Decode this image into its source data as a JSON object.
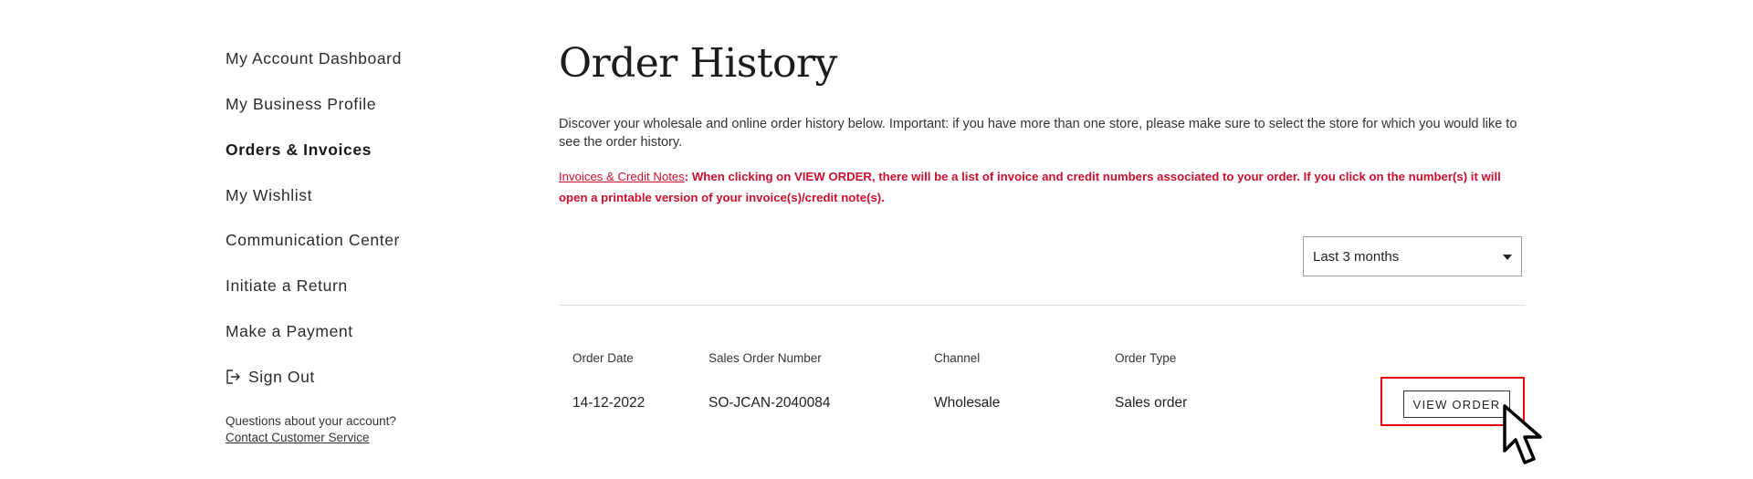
{
  "sidebar": {
    "items": [
      {
        "label": "My Account Dashboard"
      },
      {
        "label": "My Business Profile"
      },
      {
        "label": "Orders & Invoices"
      },
      {
        "label": "My Wishlist"
      },
      {
        "label": "Communication Center"
      },
      {
        "label": "Initiate a Return"
      },
      {
        "label": "Make a Payment"
      },
      {
        "label": "Sign Out"
      }
    ],
    "help_text": "Questions about your account?",
    "help_link": "Contact Customer Service"
  },
  "main": {
    "title": "Order History",
    "intro": "Discover your wholesale and online order history below. Important: if you have more than one store, please make sure to select the store for which you would like to see the order history.",
    "notice_link": "Invoices & Credit Notes",
    "notice_text": ": When clicking on VIEW ORDER, there will be a list of invoice and credit numbers associated to your order. If you click on the number(s) it will open a printable version of your invoice(s)/credit note(s).",
    "period_select": {
      "value": "Last 3 months"
    },
    "table": {
      "headers": [
        "Order Date",
        "Sales Order Number",
        "Channel",
        "Order Type"
      ],
      "rows": [
        {
          "date": "14-12-2022",
          "number": "SO-JCAN-2040084",
          "channel": "Wholesale",
          "type": "Sales order",
          "action": "VIEW ORDER"
        }
      ]
    }
  },
  "colors": {
    "accent_red": "#c8102e",
    "highlight": "#e8000b"
  }
}
